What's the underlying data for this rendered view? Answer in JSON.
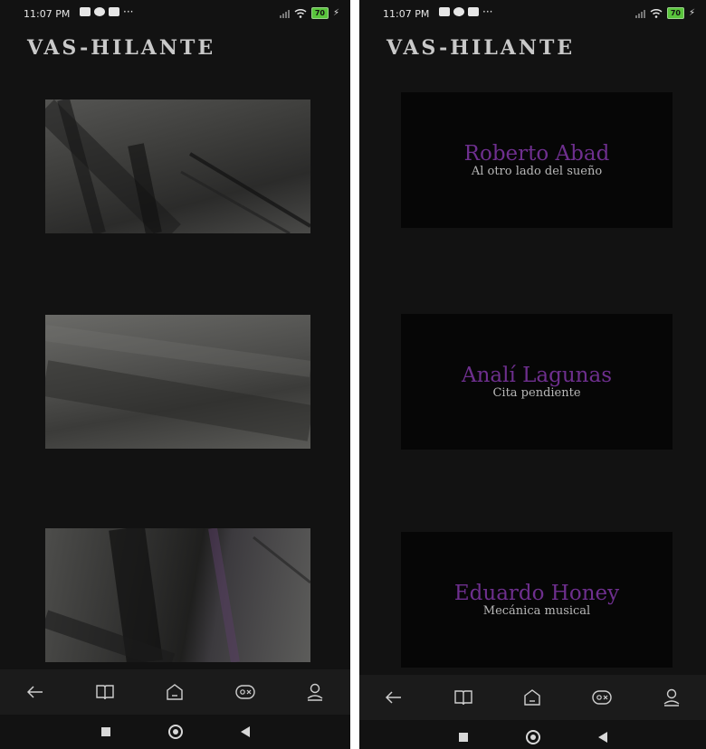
{
  "status": {
    "time": "11:07 PM",
    "battery": "70"
  },
  "app": {
    "title": "VAS-HILANTE"
  },
  "stories": [
    {
      "author": "Roberto Abad",
      "title": "Al otro lado del sueño"
    },
    {
      "author": "Analí Lagunas",
      "title": "Cita pendiente"
    },
    {
      "author": "Eduardo Honey",
      "title": "Mecánica musical"
    }
  ],
  "nav": [
    "back-arrow-icon",
    "book-icon",
    "home-icon",
    "gamepad-icon",
    "user-icon"
  ],
  "system_nav": [
    "recents-square-icon",
    "home-circle-icon",
    "back-triangle-icon"
  ],
  "colors": {
    "background": "#121212",
    "author": "#6e2f8e",
    "subtitle": "#b8b8b8",
    "battery": "#59c53c"
  }
}
